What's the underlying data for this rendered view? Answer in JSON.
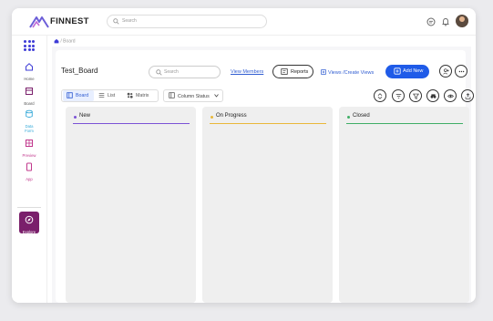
{
  "app": {
    "brand": "FINNEST"
  },
  "topbar": {
    "search_placeholder": "Search"
  },
  "breadcrumb": {
    "sep": "/",
    "current": "Board"
  },
  "sidebar": {
    "items": [
      {
        "label": "Home",
        "color": "#3d3bd6"
      },
      {
        "label": "Board",
        "color": "#7a1f6b"
      },
      {
        "label": "Data\nForm",
        "color": "#35a9d8"
      },
      {
        "label": "Preview",
        "color": "#c1378c"
      },
      {
        "label": "App",
        "color": "#c1378c"
      }
    ],
    "explore": {
      "label": "Explore",
      "bg": "#7a1f6b"
    }
  },
  "board": {
    "title": "Test_Board",
    "search_placeholder": "Search",
    "view_members": "View Members",
    "reports": "Reports",
    "views": "Views /Create Views",
    "add_new": "Add New",
    "action_icons": [
      "person-add-icon",
      "more-icon",
      "sort-icon",
      "filter-lines-icon",
      "funnel-icon",
      "binoculars-icon",
      "eye-icon",
      "share-icon"
    ]
  },
  "tabs": [
    {
      "label": "Board",
      "active": true
    },
    {
      "label": "List",
      "active": false
    },
    {
      "label": "Matrix",
      "active": false
    }
  ],
  "column_selector": {
    "label": "Column Status"
  },
  "columns": [
    {
      "name": "New",
      "color": "#7b52d6"
    },
    {
      "name": "On Progress",
      "color": "#e9b83a"
    },
    {
      "name": "Closed",
      "color": "#3fae66"
    }
  ]
}
